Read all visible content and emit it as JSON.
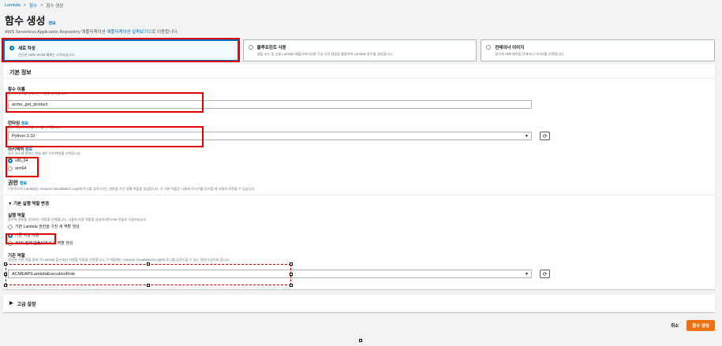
{
  "breadcrumb": {
    "item1": "Lambda",
    "item2": "함수",
    "item3": "함수 생성",
    "sep": ">"
  },
  "page": {
    "title": "함수 생성",
    "info": "정보",
    "subtitle_pre": "AWS Serverless Application Repository 애플리케이션 ",
    "subtitle_link": "애플리케이션 살펴보기",
    "subtitle_post": "으로 이용합니다."
  },
  "options": [
    {
      "title": "새로 작성",
      "desc": "간단한 Hello World 예제는 시작하십시오."
    },
    {
      "title": "블루프린트 사용",
      "desc": "샘플 코드 및 공통 Lambda 애플리케이션용 구성 사전 설정을 활용하여 Lambda 함수를 생성합니다."
    },
    {
      "title": "컨테이너 이미지",
      "desc": "함수에 대해 배포할 컨테이너 이미지를 선택합니다."
    }
  ],
  "basic": {
    "header": "기본 정보",
    "fn_label": "함수 이름",
    "fn_desc": "함수의 용도를 설명하는 이름을 입력합니다.",
    "fn_value": "acme_get_product",
    "runtime_label": "런타임",
    "runtime_info": "정보",
    "runtime_desc": "함수 작성에 사용할 언어를 선택합니다.",
    "runtime_value": "Python 3.10",
    "arch_label": "아키텍처",
    "arch_info": "정보",
    "arch_desc": "함수 코드에 원하는 명령 세트 아키텍처를 선택합니다.",
    "arch_x86": "x86_64",
    "arch_arm": "arm64",
    "perm_label": "권한",
    "perm_info": "정보",
    "perm_desc": "기본적으로 Lambda는 Amazon CloudWatch Logs에 로그를 업로드하는 권한을 가진 실행 역할을 생성합니다. 이 기본 역할은 나중에 트리거를 추가할 때 사용자 지정할 수 있습니다.",
    "role_toggle": "기본 실행 역할 변경",
    "exec_role_label": "실행 역할",
    "exec_role_desc": "함수의 권한을 정의하는 역할을 선택합니다. 사용자 지정 역할을 생성하려면 IAM 콘솔로 이동하십시오.",
    "role_opt1": "기본 Lambda 권한을 가진 새 역할 생성",
    "role_opt2": "기존 역할 사용",
    "role_opt3": "AWS 정책 템플릿에서 새 역할 생성",
    "existing_label": "기존 역할",
    "existing_desc": "생성한 기존 역할 중에 이 Lambda 함수에서 사용할 역할을 선택합니다. 이 역할에는 Amazon CloudWatch Logs에 로그를 업로드할 수 있는 권한이 있어야 합니다.",
    "existing_value": "ACMEAPILambdaExecutionRole"
  },
  "advanced": {
    "label": "고급 설정",
    "caret": "▶"
  },
  "footer": {
    "cancel": "취소",
    "create": "함수 생성"
  },
  "icons": {
    "refresh": "⟳",
    "caret_down": "▼",
    "toggle": "▼"
  }
}
